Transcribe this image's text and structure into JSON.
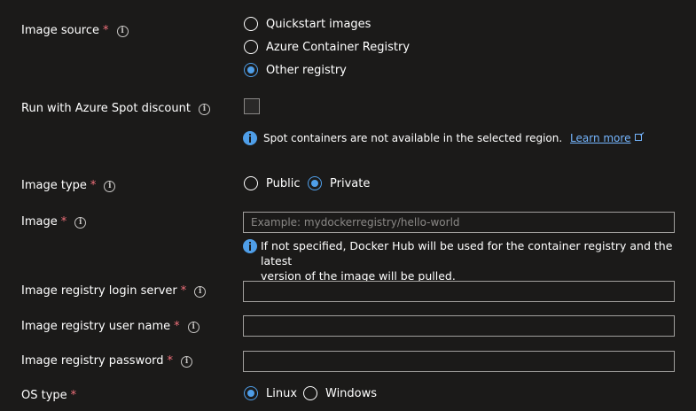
{
  "image_source": {
    "label": "Image source",
    "required_mark": "*",
    "options": [
      "Quickstart images",
      "Azure Container Registry",
      "Other registry"
    ],
    "selected": "Other registry"
  },
  "spot": {
    "label": "Run with Azure Spot discount",
    "checked": false,
    "info_text": "Spot containers are not available in the selected region.",
    "learn_more": "Learn more"
  },
  "image_type": {
    "label": "Image type",
    "required_mark": "*",
    "options": [
      "Public",
      "Private"
    ],
    "selected": "Private"
  },
  "image": {
    "label": "Image",
    "required_mark": "*",
    "value": "",
    "placeholder": "Example: mydockerregistry/hello-world",
    "info_line1": "If not specified, Docker Hub will be used for the container registry and the latest",
    "info_line2": "version of the image will be pulled."
  },
  "login_server": {
    "label": "Image registry login server",
    "required_mark": "*",
    "value": ""
  },
  "user_name": {
    "label": "Image registry user name",
    "required_mark": "*",
    "value": ""
  },
  "password": {
    "label": "Image registry password",
    "required_mark": "*",
    "value": ""
  },
  "os_type": {
    "label": "OS type",
    "required_mark": "*",
    "options": [
      "Linux",
      "Windows"
    ],
    "selected": "Linux"
  },
  "colors": {
    "background": "#1b1a19",
    "accent": "#4f9ee8",
    "required": "#f1707b",
    "link": "#75b6ff"
  }
}
